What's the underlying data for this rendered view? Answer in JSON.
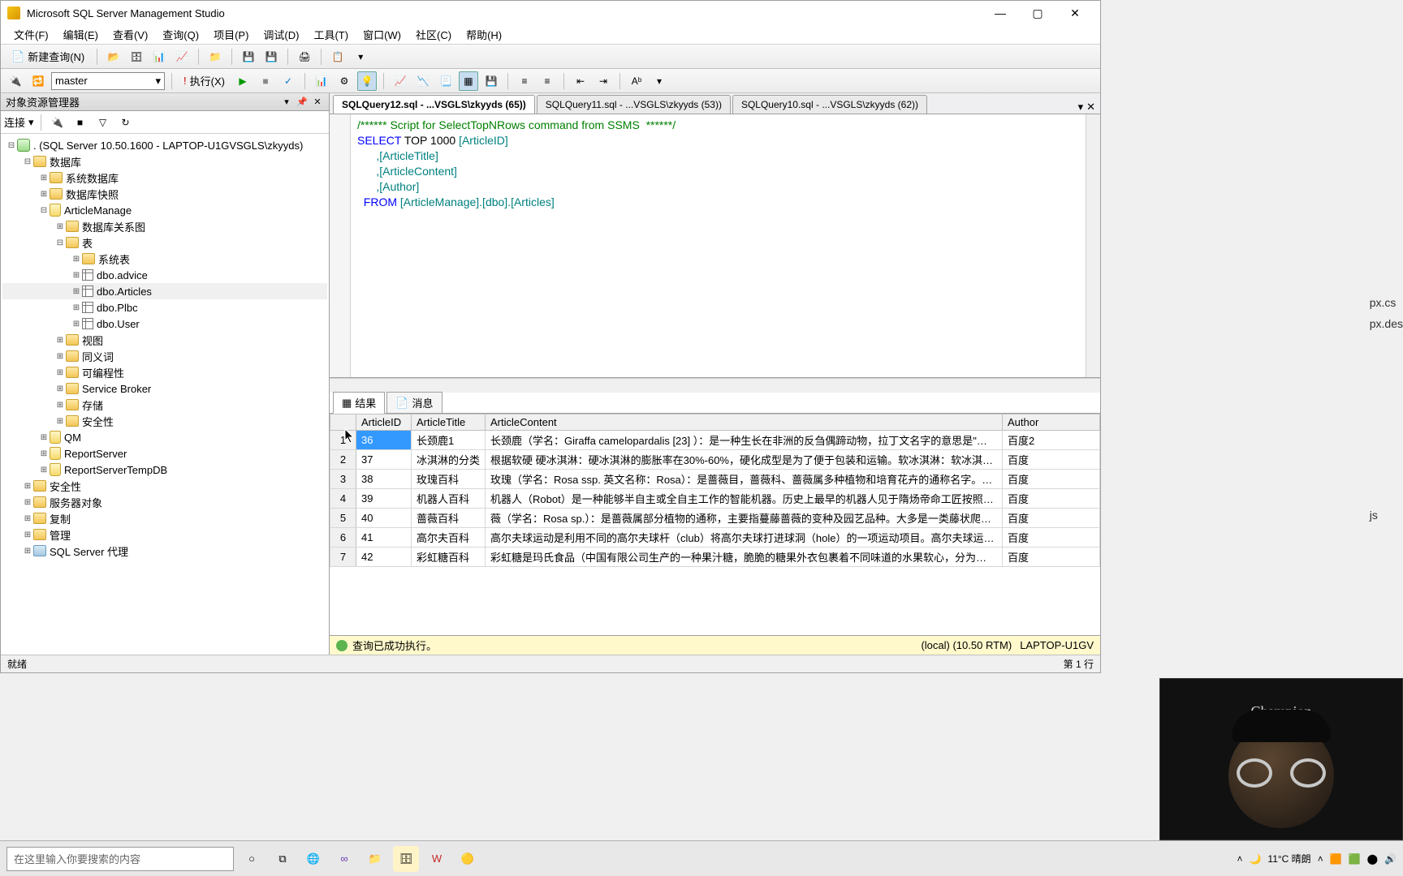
{
  "app": {
    "title": "Microsoft SQL Server Management Studio"
  },
  "menus": [
    "文件(F)",
    "编辑(E)",
    "查看(V)",
    "查询(Q)",
    "项目(P)",
    "调试(D)",
    "工具(T)",
    "窗口(W)",
    "社区(C)",
    "帮助(H)"
  ],
  "toolbar": {
    "new_query": "新建查询(N)",
    "current_db": "master",
    "execute": "执行(X)"
  },
  "object_explorer": {
    "title": "对象资源管理器",
    "connect_label": "连接",
    "server": ". (SQL Server 10.50.1600 - LAPTOP-U1GVSGLS\\zkyyds)",
    "root_db": "数据库",
    "sys_db": "系统数据库",
    "db_snapshot": "数据库快照",
    "article_db": "ArticleManage",
    "db_diagrams": "数据库关系图",
    "tables": "表",
    "sys_tables": "系统表",
    "tbl_advice": "dbo.advice",
    "tbl_articles": "dbo.Articles",
    "tbl_plbc": "dbo.Plbc",
    "tbl_user": "dbo.User",
    "views": "视图",
    "synonyms": "同义词",
    "programmability": "可编程性",
    "service_broker": "Service Broker",
    "storage": "存储",
    "security_inner": "安全性",
    "qm": "QM",
    "report_server": "ReportServer",
    "report_server_temp": "ReportServerTempDB",
    "security": "安全性",
    "server_objects": "服务器对象",
    "replication": "复制",
    "management": "管理",
    "sql_agent": "SQL Server 代理"
  },
  "tabs": [
    {
      "label": "SQLQuery12.sql - ...VSGLS\\zkyyds (65))",
      "active": true
    },
    {
      "label": "SQLQuery11.sql - ...VSGLS\\zkyyds (53))",
      "active": false
    },
    {
      "label": "SQLQuery10.sql - ...VSGLS\\zkyyds (62))",
      "active": false
    }
  ],
  "sql": {
    "comment": "/****** Script for SelectTopNRows command from SSMS  ******/",
    "l1_a": "SELECT",
    "l1_b": " TOP ",
    "l1_c": "1000",
    "l1_d": " [ArticleID]",
    "l2": "      ,[ArticleTitle]",
    "l3": "      ,[ArticleContent]",
    "l4": "      ,[Author]",
    "l5_a": "  FROM",
    "l5_b": " [ArticleManage].[dbo].[Articles]"
  },
  "result_tabs": {
    "results": "结果",
    "messages": "消息"
  },
  "grid": {
    "headers": [
      "",
      "ArticleID",
      "ArticleTitle",
      "ArticleContent",
      "Author"
    ],
    "rows": [
      {
        "n": "1",
        "id": "36",
        "title": "长颈鹿1",
        "content": "长颈鹿（学名：Giraffa camelopardalis [23]  ）：是一种生长在非洲的反刍偶蹄动物，拉丁文名字的意思是\"长着豹…",
        "author": "百度2"
      },
      {
        "n": "2",
        "id": "37",
        "title": "冰淇淋的分类",
        "content": "根据软硬 硬冰淇淋：硬冰淇淋的膨胀率在30%-60%，硬化成型是为了便于包装和运输。软冰淇淋：软冰淇淋在…",
        "author": "百度"
      },
      {
        "n": "3",
        "id": "38",
        "title": "玫瑰百科",
        "content": "玫瑰（学名：Rosa ssp. 英文名称：Rosa）：是蔷薇目，蔷薇科、蔷薇属多种植物和培育花卉的通称名字。直立…",
        "author": "百度"
      },
      {
        "n": "4",
        "id": "39",
        "title": "机器人百科",
        "content": "机器人（Robot）是一种能够半自主或全自主工作的智能机器。历史上最早的机器人见于隋炀帝命工匠按照柳抃…",
        "author": "百度"
      },
      {
        "n": "5",
        "id": "40",
        "title": "蔷薇百科",
        "content": "薇（学名：Rosa sp.）：是蔷薇属部分植物的通称，主要指蔓藤蔷薇的变种及园艺品种。大多是一类藤状爬篱笆…",
        "author": "百度"
      },
      {
        "n": "6",
        "id": "41",
        "title": "高尔夫百科",
        "content": "高尔夫球运动是利用不同的高尔夫球杆（club）将高尔夫球打进球洞（hole）的一项运动项目。高尔夫球运动是…",
        "author": "百度"
      },
      {
        "n": "7",
        "id": "42",
        "title": "彩虹糖百科",
        "content": "彩虹糖是玛氏食品（中国有限公司生产的一种果汁糖，脆脆的糖果外衣包裹着不同味道的水果软心，分为红色…",
        "author": "百度"
      }
    ]
  },
  "query_status": {
    "text": "查询已成功执行。",
    "server": "(local) (10.50 RTM)",
    "login": "LAPTOP-U1GV"
  },
  "statusbar": {
    "ready": "就绪",
    "line": "第 1 行"
  },
  "taskbar": {
    "search_placeholder": "在这里输入你要搜索的内容",
    "weather": "11°C 晴朗"
  },
  "webcam": {
    "brand": "Champion"
  },
  "bg": {
    "f1": "px.cs",
    "f2": "px.des",
    "f3": "js"
  }
}
